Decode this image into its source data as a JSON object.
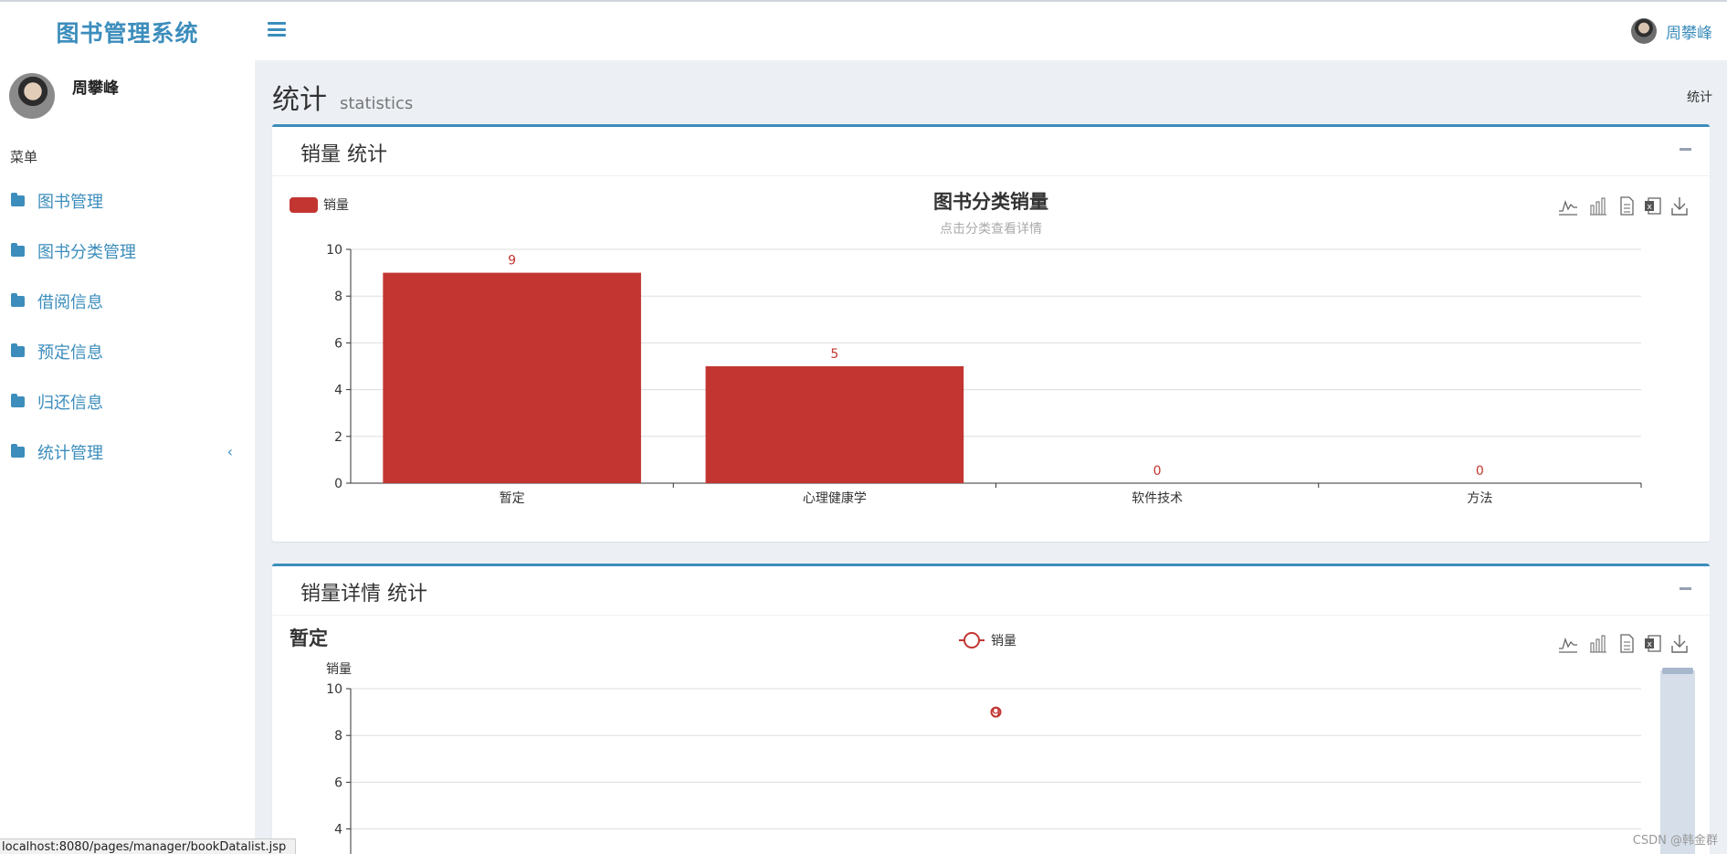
{
  "app": {
    "title": "图书管理系统"
  },
  "user": {
    "name": "周攀峰"
  },
  "sidebar": {
    "menu_header": "菜单",
    "items": [
      {
        "label": "图书管理"
      },
      {
        "label": "图书分类管理"
      },
      {
        "label": "借阅信息"
      },
      {
        "label": "预定信息"
      },
      {
        "label": "归还信息"
      },
      {
        "label": "统计管理"
      }
    ]
  },
  "content": {
    "title": "统计",
    "subtitle": "statistics",
    "breadcrumb": "统计"
  },
  "boxes": [
    {
      "title": "销量 统计"
    },
    {
      "title": "销量详情 统计"
    }
  ],
  "chart_data": [
    {
      "type": "bar",
      "title": "图书分类销量",
      "subtitle": "点击分类查看详情",
      "legend": [
        "销量"
      ],
      "legend_position": "top-left",
      "categories": [
        "暂定",
        "心理健康学",
        "软件技术",
        "方法"
      ],
      "series": [
        {
          "name": "销量",
          "values": [
            9,
            5,
            0,
            0
          ],
          "color": "#c23531"
        }
      ],
      "ylim": [
        0,
        10
      ],
      "yticks": [
        0,
        2,
        4,
        6,
        8,
        10
      ],
      "grid": true
    },
    {
      "type": "line",
      "title": "暂定",
      "legend": [
        "销量"
      ],
      "legend_position": "top-center",
      "ylabel": "销量",
      "series": [
        {
          "name": "销量",
          "values": [
            9
          ],
          "color": "#c23531"
        }
      ],
      "point_label": "9",
      "ylim": [
        0,
        10
      ],
      "yticks_visible": [
        4,
        6,
        8,
        10
      ],
      "grid": true
    }
  ],
  "toolbox_icons": [
    "line-chart-icon",
    "bar-chart-icon",
    "data-view-icon",
    "excel-icon",
    "download-icon"
  ],
  "status_bar": {
    "url": "localhost:8080/pages/manager/bookDatalist.jsp"
  },
  "watermark": "CSDN @韩金群"
}
